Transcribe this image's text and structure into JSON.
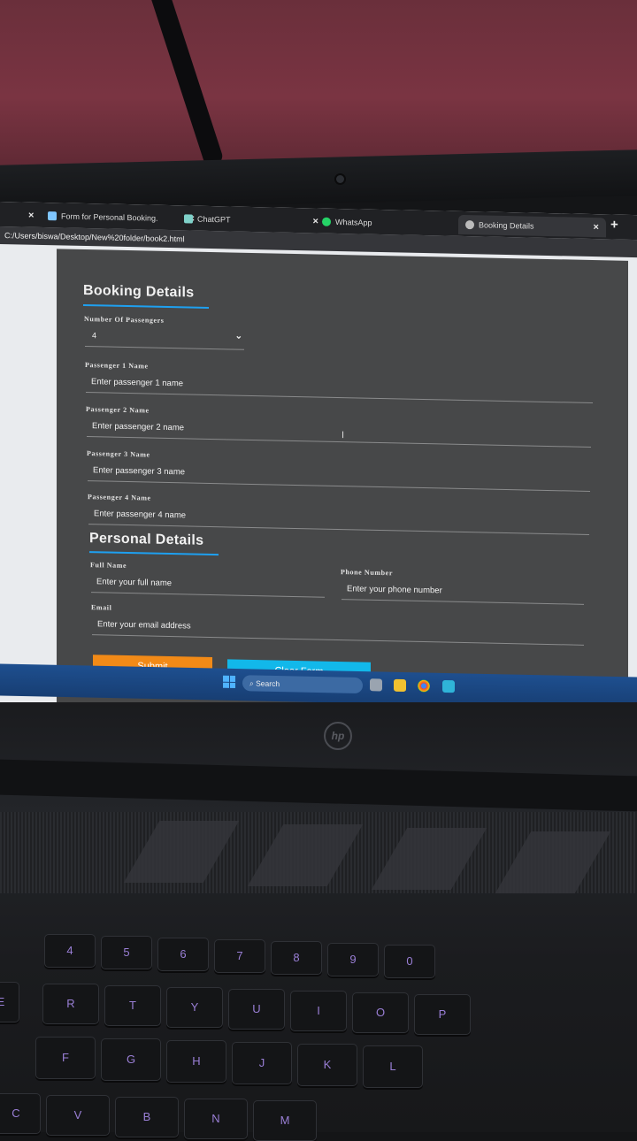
{
  "browser": {
    "tabs": [
      {
        "label": "Form for Personal Booking.",
        "close": "×"
      },
      {
        "label": "ChatGPT",
        "close": "×"
      },
      {
        "label": "WhatsApp",
        "close": "×"
      },
      {
        "label": "Booking Details",
        "close": "×"
      }
    ],
    "new_tab": "+",
    "url": "C:/Users/biswa/Desktop/New%20folder/book2.html"
  },
  "booking": {
    "title": "Booking Details",
    "passengers_label": "Number Of Passengers",
    "passengers_value": "4",
    "passengers": [
      {
        "label": "Passenger 1 Name",
        "placeholder": "Enter passenger 1 name"
      },
      {
        "label": "Passenger 2 Name",
        "placeholder": "Enter passenger 2 name"
      },
      {
        "label": "Passenger 3 Name",
        "placeholder": "Enter passenger 3 name"
      },
      {
        "label": "Passenger 4 Name",
        "placeholder": "Enter passenger 4 name"
      }
    ]
  },
  "personal": {
    "title": "Personal Details",
    "full_name_label": "Full Name",
    "full_name_placeholder": "Enter your full name",
    "phone_label": "Phone Number",
    "phone_placeholder": "Enter your phone number",
    "email_label": "Email",
    "email_placeholder": "Enter your email address"
  },
  "actions": {
    "submit": "Submit",
    "clear": "Clear Form"
  },
  "taskbar": {
    "search": "Search"
  },
  "colors": {
    "accent_underline": "#1ea0f0",
    "submit_bg": "#f28a17",
    "clear_bg": "#12b8ea",
    "form_bg": "#474849"
  },
  "keyboard": {
    "row_numbers": [
      "4",
      "5",
      "6",
      "7",
      "8",
      "9",
      "0"
    ],
    "row_top": [
      "E",
      "R",
      "T",
      "Y",
      "U",
      "I",
      "O",
      "P"
    ],
    "row_mid": [
      "F",
      "G",
      "H",
      "J",
      "K",
      "L"
    ],
    "row_bottom": [
      "C",
      "V",
      "B",
      "N",
      "M"
    ]
  }
}
